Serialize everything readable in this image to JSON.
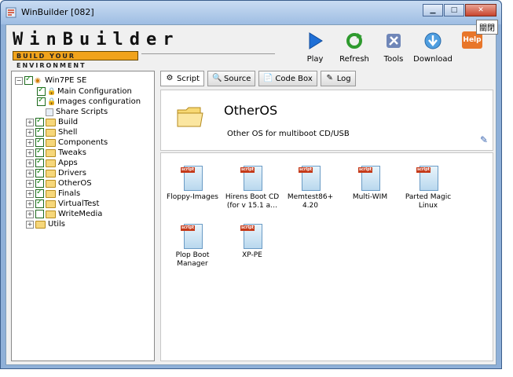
{
  "window": {
    "title": "WinBuilder [082]",
    "tooltip": "關閉"
  },
  "brand": {
    "title": "WinBuilder",
    "tagline": "BUILD YOUR ENVIRONMENT"
  },
  "toolbar": {
    "play": "Play",
    "refresh": "Refresh",
    "tools": "Tools",
    "download": "Download",
    "help": "Help"
  },
  "tree": {
    "root": "Win7PE SE",
    "items": [
      {
        "label": "Main Configuration"
      },
      {
        "label": "Images configuration"
      },
      {
        "label": "Share Scripts"
      },
      {
        "label": "Build"
      },
      {
        "label": "Shell"
      },
      {
        "label": "Components"
      },
      {
        "label": "Tweaks"
      },
      {
        "label": "Apps"
      },
      {
        "label": "Drivers"
      },
      {
        "label": "OtherOS"
      },
      {
        "label": "Finals"
      },
      {
        "label": "VirtualTest"
      },
      {
        "label": "WriteMedia"
      }
    ],
    "utils": "Utils"
  },
  "tabs": {
    "script": "Script",
    "source": "Source",
    "codebox": "Code Box",
    "log": "Log"
  },
  "script": {
    "title": "OtherOS",
    "description": "Other OS for multiboot CD/USB"
  },
  "items": [
    {
      "label": "Floppy-Images"
    },
    {
      "label": "Hirens Boot CD (for v 15.1 a…"
    },
    {
      "label": "Memtest86+ 4.20"
    },
    {
      "label": "Multi-WIM"
    },
    {
      "label": "Parted Magic Linux"
    },
    {
      "label": "Plop Boot Manager"
    },
    {
      "label": "XP-PE"
    }
  ],
  "colors": {
    "accent": "#f1a31b",
    "close": "#c8452e"
  }
}
